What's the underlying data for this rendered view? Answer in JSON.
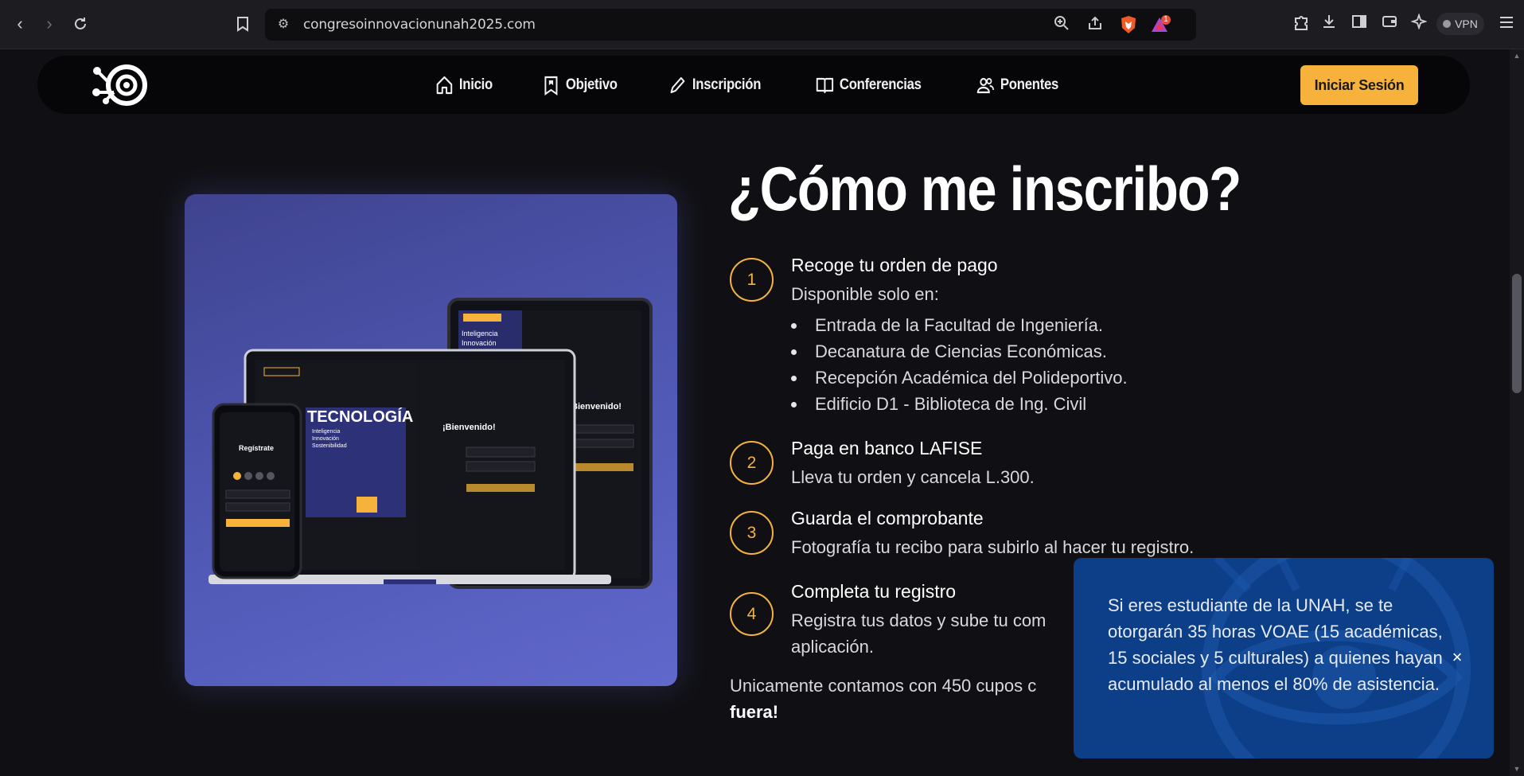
{
  "browser": {
    "url": "congresoinnovacionunah2025.com",
    "vpn_label": "VPN",
    "brave_badge": "1",
    "icons": [
      "back-icon",
      "forward-icon",
      "reload-icon",
      "bookmark-icon",
      "site-settings-icon",
      "zoom-icon",
      "share-icon",
      "brave-shield-icon",
      "brave-rewards-icon",
      "extensions-icon",
      "downloads-icon",
      "sidebar-icon",
      "wallet-icon",
      "leo-ai-icon",
      "menu-icon"
    ]
  },
  "site_nav": {
    "items": [
      {
        "label": "Inicio",
        "icon": "home-icon"
      },
      {
        "label": "Objetivo",
        "icon": "bookmark-icon"
      },
      {
        "label": "Inscripción",
        "icon": "pencil-icon"
      },
      {
        "label": "Conferencias",
        "icon": "book-icon"
      },
      {
        "label": "Ponentes",
        "icon": "users-icon"
      }
    ],
    "login_label": "Iniciar Sesión",
    "accent": "#f7b23b"
  },
  "main": {
    "title": "¿Cómo me inscribo?",
    "steps": [
      {
        "number": "1",
        "title": "Recoge tu orden de pago",
        "desc": "Disponible solo en:",
        "locations": [
          "Entrada de la Facultad de Ingeniería.",
          "Decanatura de Ciencias Económicas.",
          "Recepción Académica del Polideportivo.",
          "Edificio D1 - Biblioteca de Ing. Civil"
        ]
      },
      {
        "number": "2",
        "title": "Paga en banco LAFISE",
        "desc": "Lleva tu orden y cancela L.300."
      },
      {
        "number": "3",
        "title": "Guarda el comprobante",
        "desc": "Fotografía tu recibo para subirlo al hacer tu registro."
      },
      {
        "number": "4",
        "title": "Completa tu registro",
        "desc": "Registra tus datos y sube tu com",
        "desc2": "aplicación."
      }
    ],
    "note_text": "Unicamente contamos con 450 cupos c",
    "note_strong": "fuera!"
  },
  "toast": {
    "text": "Si eres estudiante de la UNAH, se te otorgarán 35 horas VOAE (15 académicas, 15 sociales y 5 culturales) a quienes hayan acumulado al menos el 80% de asistencia.",
    "close_label": "×",
    "bg_color": "#0d3e88"
  },
  "mockup": {
    "phone_title": "Regístrate",
    "laptop_title": "¡Bienvenido!",
    "tablet_title": "Bienvenido!",
    "poster_word": "TECNOLOGÍA",
    "poster_lines": [
      "Inteligencia",
      "Innovación",
      "Sostenibilidad"
    ]
  }
}
